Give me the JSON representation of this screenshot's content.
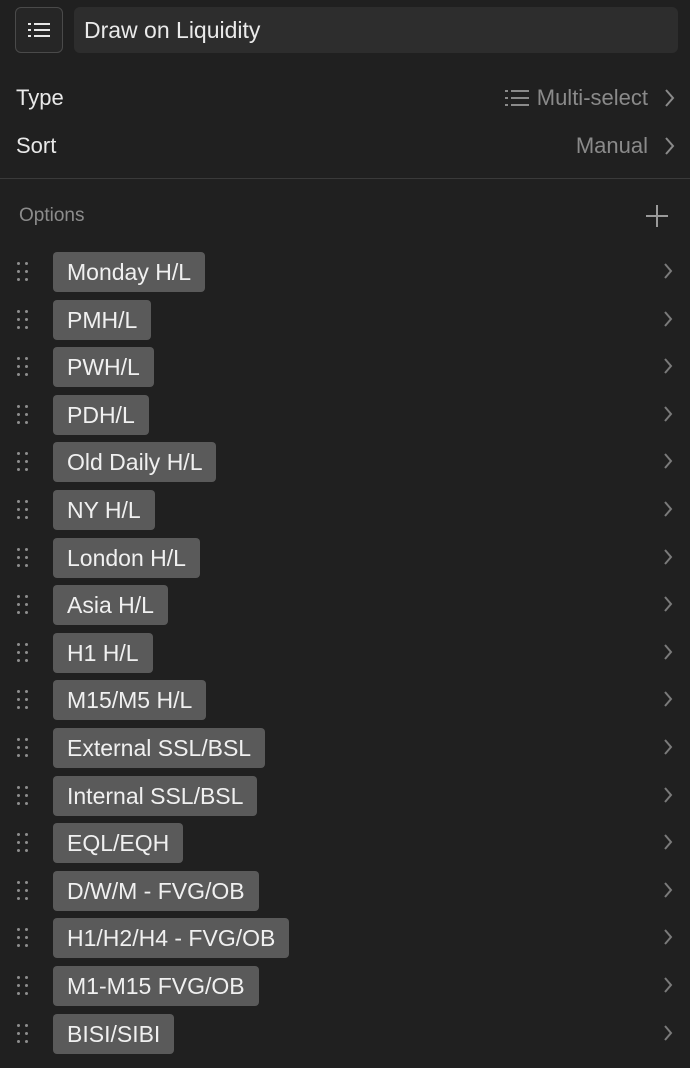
{
  "header": {
    "menu_icon": "list-icon",
    "title": "Draw on Liquidity"
  },
  "properties": [
    {
      "label": "Type",
      "value": "Multi-select",
      "value_icon": "list-icon"
    },
    {
      "label": "Sort",
      "value": "Manual"
    }
  ],
  "options_section": {
    "label": "Options",
    "add_icon": "plus-icon"
  },
  "options": [
    "Monday H/L",
    "PMH/L",
    "PWH/L",
    "PDH/L",
    "Old Daily H/L",
    "NY H/L",
    "London H/L",
    "Asia H/L",
    "H1 H/L",
    "M15/M5 H/L",
    "External SSL/BSL",
    "Internal SSL/BSL",
    "EQL/EQH",
    "D/W/M - FVG/OB",
    "H1/H2/H4 - FVG/OB",
    "M1-M15 FVG/OB",
    "BISI/SIBI"
  ]
}
